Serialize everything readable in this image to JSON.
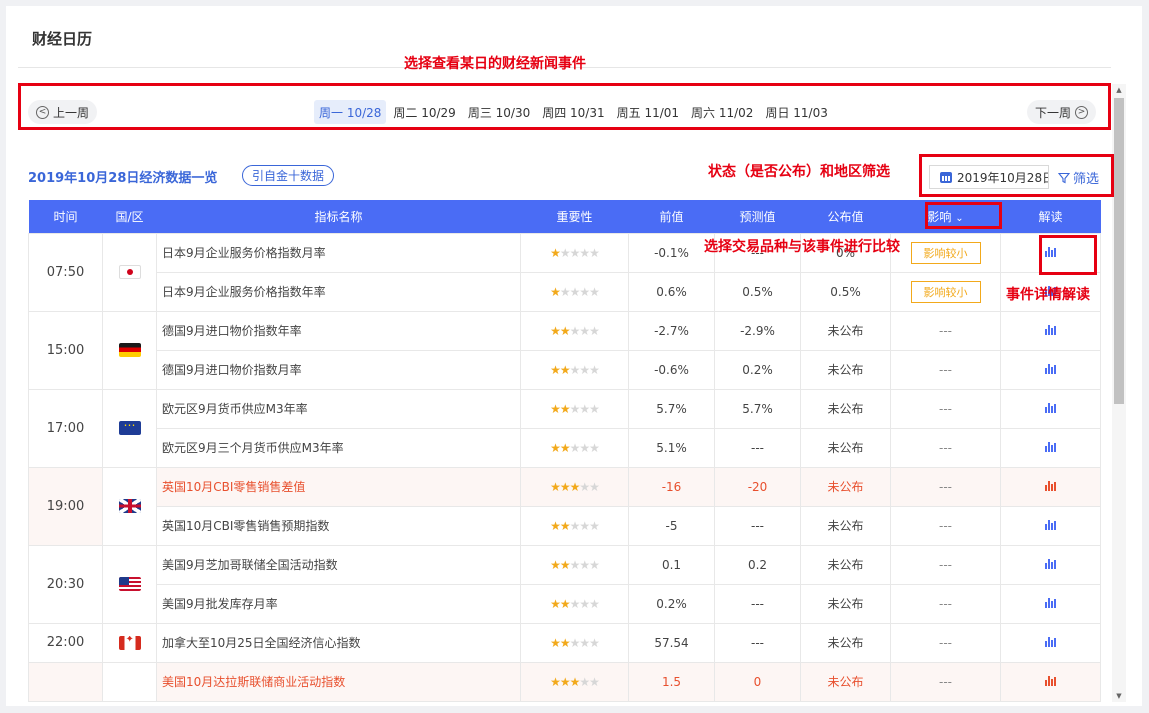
{
  "page_title": "财经日历",
  "annotations": {
    "select_date": "选择查看某日的财经新闻事件",
    "status_region": "状态（是否公布）和地区筛选",
    "compare": "选择交易品种与该事件进行比较",
    "details": "事件详情解读"
  },
  "week_nav": {
    "prev_label": "上一周",
    "next_label": "下一周",
    "days": [
      "周一 10/28",
      "周二 10/29",
      "周三 10/30",
      "周四 10/31",
      "周五 11/01",
      "周六 11/02",
      "周日 11/03"
    ],
    "active_index": 0
  },
  "summary_title": "2019年10月28日经济数据一览",
  "source_pill": "引自金十数据",
  "date_picker_value": "2019年10月28日",
  "filter_label": "筛选",
  "table": {
    "headers": {
      "time": "时间",
      "region": "国/区",
      "name": "指标名称",
      "importance": "重要性",
      "previous": "前值",
      "forecast": "预测值",
      "actual": "公布值",
      "impact": "影响",
      "interpret": "解读"
    },
    "groups": [
      {
        "time": "07:50",
        "flag": "japan-flag-icon",
        "rows": [
          {
            "name": "日本9月企业服务价格指数月率",
            "stars": 1,
            "previous": "-0.1%",
            "forecast": "---",
            "actual": "0%",
            "impact": "影响较小",
            "highlight": false
          },
          {
            "name": "日本9月企业服务价格指数年率",
            "stars": 1,
            "previous": "0.6%",
            "forecast": "0.5%",
            "actual": "0.5%",
            "impact": "影响较小",
            "highlight": false
          }
        ]
      },
      {
        "time": "15:00",
        "flag": "germany-flag-icon",
        "rows": [
          {
            "name": "德国9月进口物价指数年率",
            "stars": 2,
            "previous": "-2.7%",
            "forecast": "-2.9%",
            "actual": "未公布",
            "impact": "---",
            "highlight": false
          },
          {
            "name": "德国9月进口物价指数月率",
            "stars": 2,
            "previous": "-0.6%",
            "forecast": "0.2%",
            "actual": "未公布",
            "impact": "---",
            "highlight": false
          }
        ]
      },
      {
        "time": "17:00",
        "flag": "eu-flag-icon",
        "rows": [
          {
            "name": "欧元区9月货币供应M3年率",
            "stars": 2,
            "previous": "5.7%",
            "forecast": "5.7%",
            "actual": "未公布",
            "impact": "---",
            "highlight": false
          },
          {
            "name": "欧元区9月三个月货币供应M3年率",
            "stars": 2,
            "previous": "5.1%",
            "forecast": "---",
            "actual": "未公布",
            "impact": "---",
            "highlight": false
          }
        ]
      },
      {
        "time": "19:00",
        "flag": "uk-flag-icon",
        "rows": [
          {
            "name": "英国10月CBI零售销售差值",
            "stars": 3,
            "previous": "-16",
            "forecast": "-20",
            "actual": "未公布",
            "impact": "---",
            "highlight": true
          },
          {
            "name": "英国10月CBI零售销售预期指数",
            "stars": 2,
            "previous": "-5",
            "forecast": "---",
            "actual": "未公布",
            "impact": "---",
            "highlight": false
          }
        ]
      },
      {
        "time": "20:30",
        "flag": "us-flag-icon",
        "rows": [
          {
            "name": "美国9月芝加哥联储全国活动指数",
            "stars": 2,
            "previous": "0.1",
            "forecast": "0.2",
            "actual": "未公布",
            "impact": "---",
            "highlight": false
          },
          {
            "name": "美国9月批发库存月率",
            "stars": 2,
            "previous": "0.2%",
            "forecast": "---",
            "actual": "未公布",
            "impact": "---",
            "highlight": false
          }
        ]
      },
      {
        "time": "22:00",
        "flag": "canada-flag-icon",
        "rows": [
          {
            "name": "加拿大至10月25日全国经济信心指数",
            "stars": 2,
            "previous": "57.54",
            "forecast": "---",
            "actual": "未公布",
            "impact": "---",
            "highlight": false
          }
        ]
      },
      {
        "time": "",
        "flag": "",
        "rows": [
          {
            "name": "美国10月达拉斯联储商业活动指数",
            "stars": 3,
            "previous": "1.5",
            "forecast": "0",
            "actual": "未公布",
            "impact": "---",
            "highlight": true
          }
        ]
      }
    ]
  },
  "colors": {
    "accent": "#4a6cf5",
    "annotation": "#e60012",
    "highlight": "#e8502e",
    "star": "#f2a91b"
  }
}
